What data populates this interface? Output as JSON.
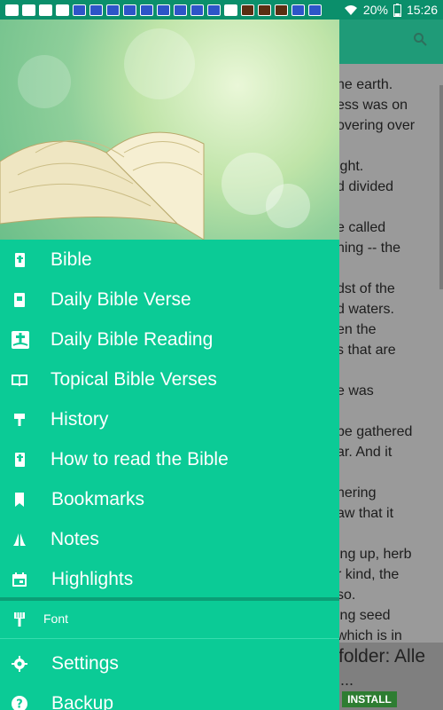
{
  "status_bar": {
    "battery_percent": "20%",
    "time": "15:26"
  },
  "background": {
    "text_lines": [
      "he earth.",
      "ess was on",
      "overing over",
      "",
      "ight.",
      "d divided",
      "",
      "e called",
      "ning -- the",
      "",
      "dst of the",
      "d waters.",
      "en the",
      "s that are",
      "",
      "e was",
      "",
      "be gathered",
      "ar. And it",
      "",
      "hering",
      "aw that it",
      "",
      "ing up, herb",
      "r kind,  the",
      "so.",
      "ing seed",
      "which is  in"
    ],
    "ad_title": "folder: Alle",
    "ad_ellipsis": "...",
    "install_label": "INSTALL"
  },
  "drawer": {
    "items": [
      {
        "label": "Bible",
        "icon": "bible-icon"
      },
      {
        "label": "Daily Bible Verse",
        "icon": "daily-verse-icon"
      },
      {
        "label": "Daily Bible Reading",
        "icon": "daily-reading-icon"
      },
      {
        "label": "Topical Bible Verses",
        "icon": "open-book-icon"
      },
      {
        "label": "History",
        "icon": "history-brush-icon"
      },
      {
        "label": "How to read the Bible",
        "icon": "bible-cross-icon"
      },
      {
        "label": "Bookmarks",
        "icon": "bookmark-icon"
      },
      {
        "label": "Notes",
        "icon": "praying-hands-icon"
      },
      {
        "label": "Highlights",
        "icon": "calendar-icon"
      }
    ],
    "font_label": "Font",
    "lower_items": [
      {
        "label": "Settings",
        "icon": "gear-icon"
      },
      {
        "label": "Backup",
        "icon": "help-icon"
      }
    ]
  },
  "colors": {
    "drawer_bg": "#0bcb96",
    "status_bar": "#0b8f6b",
    "install_button": "#2e7d32"
  }
}
